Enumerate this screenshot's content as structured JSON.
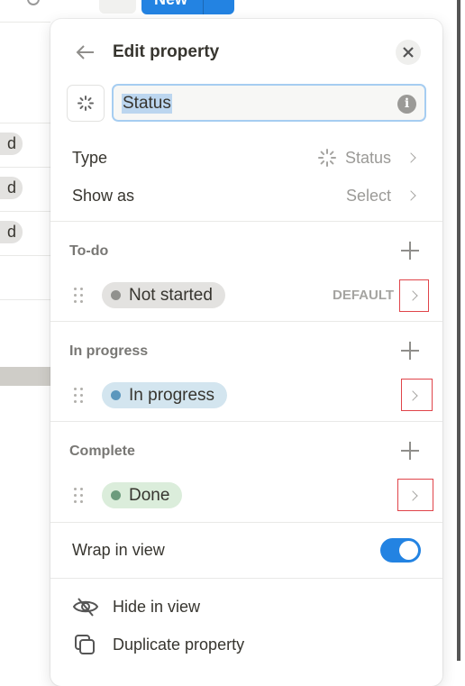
{
  "toolbar": {
    "new_label": "New"
  },
  "background": {
    "row_tags": [
      "d",
      "d",
      "d"
    ]
  },
  "panel": {
    "title": "Edit property",
    "name_value": "Status",
    "type_label": "Type",
    "type_value": "Status",
    "show_as_label": "Show as",
    "show_as_value": "Select",
    "groups": [
      {
        "label": "To-do",
        "options": [
          {
            "label": "Not started",
            "color": "#91918e",
            "bg": "#e3e2e0",
            "default": "DEFAULT"
          }
        ]
      },
      {
        "label": "In progress",
        "options": [
          {
            "label": "In progress",
            "color": "#5b97bd",
            "bg": "#d3e5ef"
          }
        ]
      },
      {
        "label": "Complete",
        "options": [
          {
            "label": "Done",
            "color": "#6c9b7d",
            "bg": "#dbeddb"
          }
        ]
      }
    ],
    "wrap_label": "Wrap in view",
    "wrap_on": true,
    "actions": [
      {
        "label": "Hide in view",
        "icon": "eye-off-icon"
      },
      {
        "label": "Duplicate property",
        "icon": "duplicate-icon"
      }
    ]
  },
  "colors": {
    "accent": "#2383e2"
  }
}
